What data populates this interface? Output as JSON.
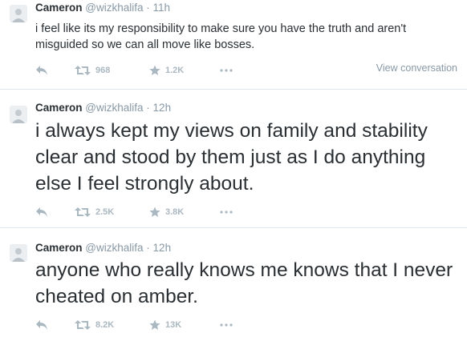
{
  "tweets": [
    {
      "name": "Cameron",
      "handle": "@wizkhalifa",
      "separator": "·",
      "time": "11h",
      "text": "i feel like its my responsibility to make sure you have the truth and aren't misguided so we can all move like bosses.",
      "retweets": "968",
      "favorites": "1.2K",
      "view_conversation": "View conversation"
    },
    {
      "name": "Cameron",
      "handle": "@wizkhalifa",
      "separator": "·",
      "time": "12h",
      "text": "i always kept my views on family and stability clear and stood by them just as I do anything else I feel strongly about.",
      "retweets": "2.5K",
      "favorites": "3.8K"
    },
    {
      "name": "Cameron",
      "handle": "@wizkhalifa",
      "separator": "·",
      "time": "12h",
      "text": "anyone who really knows me knows that I never cheated on amber.",
      "retweets": "8.2K",
      "favorites": "13K"
    }
  ],
  "icons": {
    "reply": "reply-icon",
    "retweet": "retweet-icon",
    "favorite": "star-icon",
    "more": "more-icon"
  },
  "colors": {
    "name": "#292f33",
    "meta": "#8899a6",
    "action_icons": "#aab8c2",
    "divider": "#e1e8ed"
  }
}
